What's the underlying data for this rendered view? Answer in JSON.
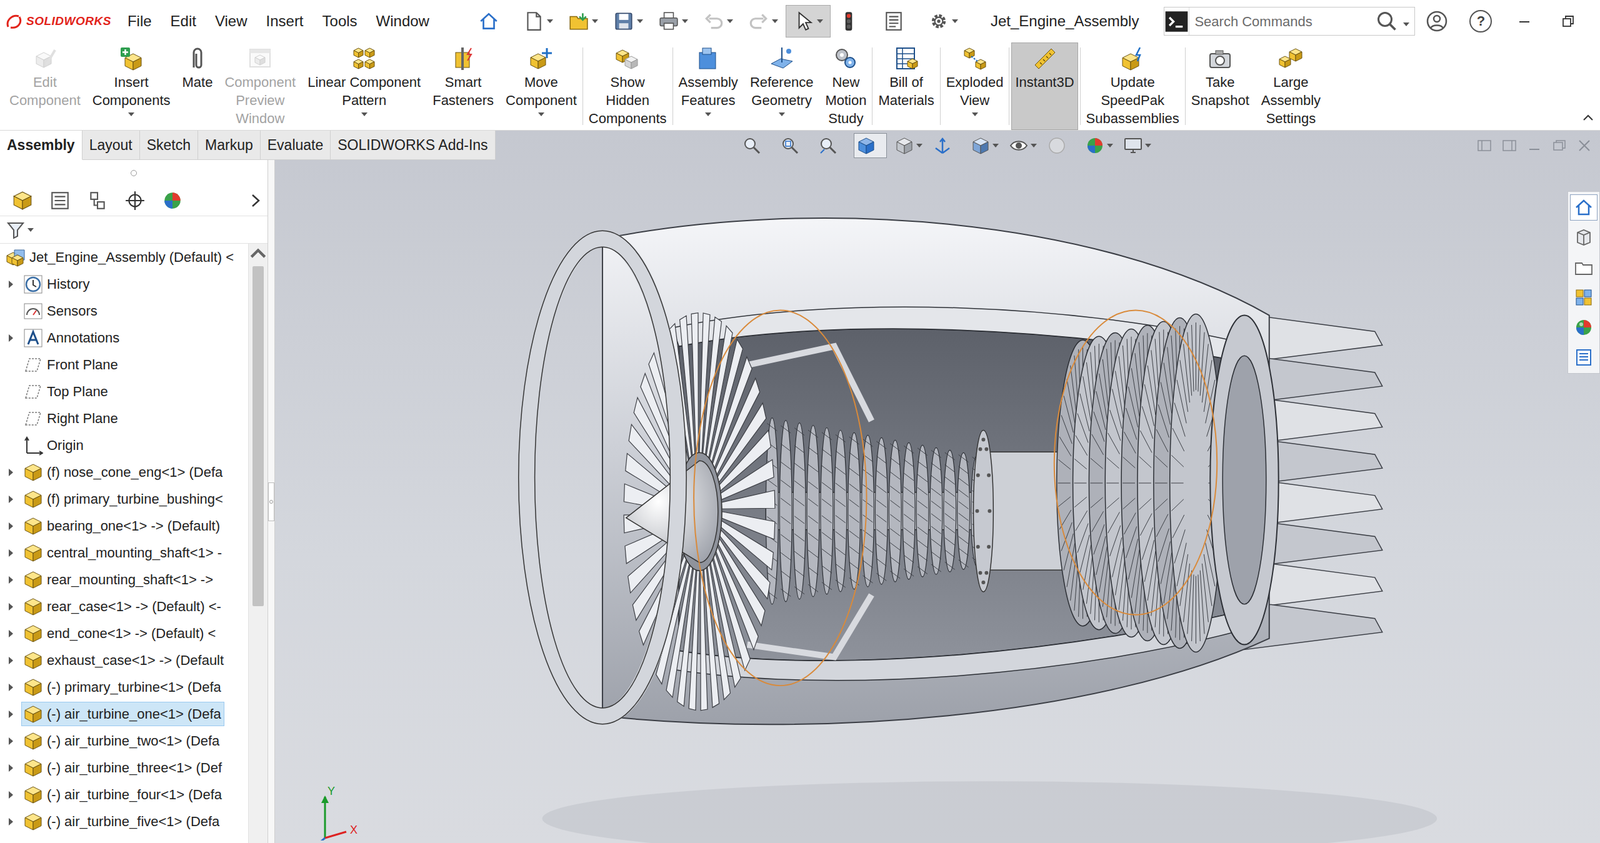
{
  "window": {
    "app": "SOLIDWORKS",
    "title": "Jet_Engine_Assembly",
    "help": "?"
  },
  "menu": [
    "File",
    "Edit",
    "View",
    "Insert",
    "Tools",
    "Window"
  ],
  "quick_access": [
    {
      "pressed": false,
      "dropdown": false,
      "disabled": false
    },
    {
      "pressed": false,
      "dropdown": true,
      "disabled": false
    },
    {
      "pressed": false,
      "dropdown": true,
      "disabled": false
    },
    {
      "pressed": false,
      "dropdown": true,
      "disabled": false
    },
    {
      "pressed": false,
      "dropdown": true,
      "disabled": false
    },
    {
      "pressed": false,
      "dropdown": true,
      "disabled": true
    },
    {
      "pressed": false,
      "dropdown": true,
      "disabled": true
    },
    {
      "pressed": true,
      "dropdown": true,
      "disabled": false
    },
    {
      "pressed": false,
      "dropdown": false,
      "disabled": false
    },
    {
      "pressed": false,
      "dropdown": false,
      "disabled": false
    },
    {
      "pressed": false,
      "dropdown": true,
      "disabled": false
    }
  ],
  "search": {
    "placeholder": "Search Commands"
  },
  "ribbon": [
    {
      "lines": [
        "Edit",
        "Component"
      ],
      "disabled": true,
      "dropdown": false,
      "selected": false,
      "sep": false
    },
    {
      "lines": [
        "Insert",
        "Components"
      ],
      "disabled": false,
      "dropdown": true,
      "selected": false,
      "sep": false
    },
    {
      "lines": [
        "Mate"
      ],
      "disabled": false,
      "dropdown": false,
      "selected": false,
      "sep": false
    },
    {
      "lines": [
        "Component",
        "Preview",
        "Window"
      ],
      "disabled": true,
      "dropdown": false,
      "selected": false,
      "sep": false
    },
    {
      "lines": [
        "Linear Component",
        "Pattern"
      ],
      "disabled": false,
      "dropdown": true,
      "selected": false,
      "sep": false
    },
    {
      "lines": [
        "Smart",
        "Fasteners"
      ],
      "disabled": false,
      "dropdown": false,
      "selected": false,
      "sep": false
    },
    {
      "lines": [
        "Move",
        "Component"
      ],
      "disabled": false,
      "dropdown": true,
      "selected": false,
      "sep": false
    },
    {
      "lines": [
        "Show",
        "Hidden",
        "Components"
      ],
      "disabled": false,
      "dropdown": false,
      "selected": false,
      "sep": true
    },
    {
      "lines": [
        "Assembly",
        "Features"
      ],
      "disabled": false,
      "dropdown": true,
      "selected": false,
      "sep": true
    },
    {
      "lines": [
        "Reference",
        "Geometry"
      ],
      "disabled": false,
      "dropdown": true,
      "selected": false,
      "sep": false
    },
    {
      "lines": [
        "New",
        "Motion",
        "Study"
      ],
      "disabled": false,
      "dropdown": false,
      "selected": false,
      "sep": false
    },
    {
      "lines": [
        "Bill of",
        "Materials"
      ],
      "disabled": false,
      "dropdown": false,
      "selected": false,
      "sep": true
    },
    {
      "lines": [
        "Exploded",
        "View"
      ],
      "disabled": false,
      "dropdown": true,
      "selected": false,
      "sep": true
    },
    {
      "lines": [
        "Instant3D"
      ],
      "disabled": false,
      "dropdown": false,
      "selected": true,
      "sep": true
    },
    {
      "lines": [
        "Update",
        "SpeedPak",
        "Subassemblies"
      ],
      "disabled": false,
      "dropdown": false,
      "selected": false,
      "sep": true
    },
    {
      "lines": [
        "Take",
        "Snapshot"
      ],
      "disabled": false,
      "dropdown": false,
      "selected": false,
      "sep": true
    },
    {
      "lines": [
        "Large",
        "Assembly",
        "Settings"
      ],
      "disabled": false,
      "dropdown": false,
      "selected": false,
      "sep": false
    }
  ],
  "tabs": [
    {
      "label": "Assembly",
      "selected": true
    },
    {
      "label": "Layout",
      "selected": false
    },
    {
      "label": "Sketch",
      "selected": false
    },
    {
      "label": "Markup",
      "selected": false
    },
    {
      "label": "Evaluate",
      "selected": false
    },
    {
      "label": "SOLIDWORKS Add-Ins",
      "selected": false
    }
  ],
  "view_toolbar": [
    {
      "pressed": false,
      "dropdown": false
    },
    {
      "pressed": false,
      "dropdown": false
    },
    {
      "pressed": false,
      "dropdown": false
    },
    {
      "pressed": true,
      "dropdown": false
    },
    {
      "pressed": false,
      "dropdown": true
    },
    {
      "pressed": false,
      "dropdown": false
    },
    {
      "pressed": false,
      "dropdown": true
    },
    {
      "pressed": false,
      "dropdown": true
    },
    {
      "pressed": false,
      "dropdown": false
    },
    {
      "pressed": false,
      "dropdown": true
    },
    {
      "pressed": false,
      "dropdown": true
    }
  ],
  "tree": {
    "root": "Jet_Engine_Assembly (Default) <",
    "items": [
      {
        "label": "History",
        "kind": "history",
        "expandable": true,
        "selected": false
      },
      {
        "label": "Sensors",
        "kind": "sensors",
        "expandable": false,
        "selected": false
      },
      {
        "label": "Annotations",
        "kind": "annotations",
        "expandable": true,
        "selected": false
      },
      {
        "label": "Front Plane",
        "kind": "plane",
        "expandable": false,
        "selected": false
      },
      {
        "label": "Top Plane",
        "kind": "plane",
        "expandable": false,
        "selected": false
      },
      {
        "label": "Right Plane",
        "kind": "plane",
        "expandable": false,
        "selected": false
      },
      {
        "label": "Origin",
        "kind": "origin",
        "expandable": false,
        "selected": false
      },
      {
        "label": "(f) nose_cone_eng<1> (Defa",
        "kind": "part",
        "expandable": true,
        "selected": false
      },
      {
        "label": "(f) primary_turbine_bushing<",
        "kind": "part",
        "expandable": true,
        "selected": false
      },
      {
        "label": "bearing_one<1> -> (Default)",
        "kind": "part",
        "expandable": true,
        "selected": false
      },
      {
        "label": "central_mounting_shaft<1> -",
        "kind": "part",
        "expandable": true,
        "selected": false
      },
      {
        "label": "rear_mounting_shaft<1> ->",
        "kind": "part",
        "expandable": true,
        "selected": false
      },
      {
        "label": "rear_case<1> -> (Default) <-",
        "kind": "part",
        "expandable": true,
        "selected": false
      },
      {
        "label": "end_cone<1> -> (Default) <",
        "kind": "part",
        "expandable": true,
        "selected": false
      },
      {
        "label": "exhaust_case<1> -> (Default",
        "kind": "part",
        "expandable": true,
        "selected": false
      },
      {
        "label": "(-) primary_turbine<1> (Defa",
        "kind": "part",
        "expandable": true,
        "selected": false
      },
      {
        "label": "(-) air_turbine_one<1> (Defa",
        "kind": "part",
        "expandable": true,
        "selected": true
      },
      {
        "label": "(-) air_turbine_two<1> (Defa",
        "kind": "part",
        "expandable": true,
        "selected": false
      },
      {
        "label": "(-) air_turbine_three<1> (Def",
        "kind": "part",
        "expandable": true,
        "selected": false
      },
      {
        "label": "(-) air_turbine_four<1> (Defa",
        "kind": "part",
        "expandable": true,
        "selected": false
      },
      {
        "label": "(-) air_turbine_five<1> (Defa",
        "kind": "part",
        "expandable": true,
        "selected": false
      }
    ]
  },
  "triad": {
    "y": "Y",
    "x": "X"
  }
}
